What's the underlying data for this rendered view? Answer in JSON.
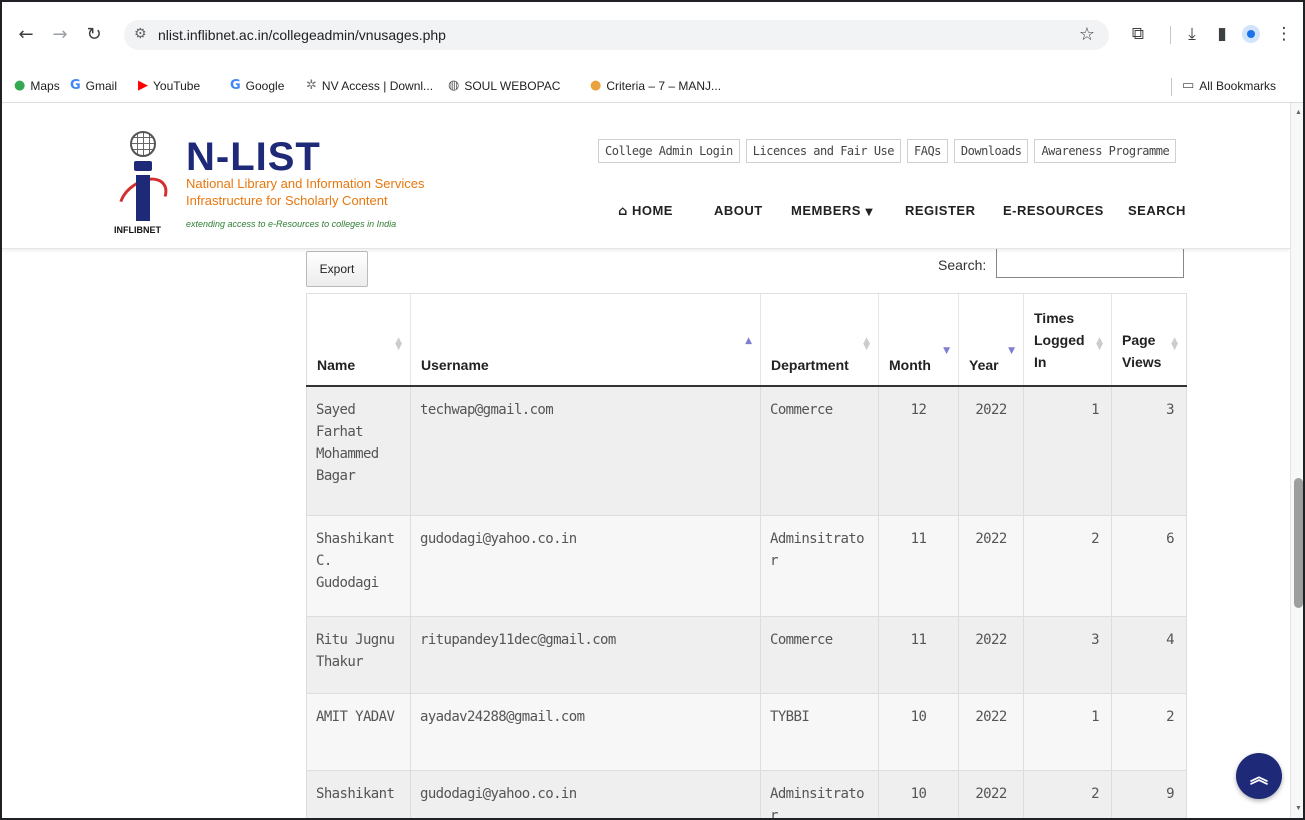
{
  "browser": {
    "url": "nlist.inflibnet.ac.in/collegeadmin/vnusages.php",
    "bookmarks": [
      {
        "label": "Maps",
        "icon": "maps-pin-icon"
      },
      {
        "label": "Gmail",
        "icon": "google-g-icon"
      },
      {
        "label": "YouTube",
        "icon": "youtube-icon"
      },
      {
        "label": "Google",
        "icon": "google-g-icon"
      },
      {
        "label": "NV Access | Downl...",
        "icon": "nv-access-icon"
      },
      {
        "label": "SOUL WEBOPAC",
        "icon": "globe-icon"
      },
      {
        "label": "Criteria – 7 – MANJ...",
        "icon": "site-favicon-icon"
      }
    ],
    "all_bookmarks": "All Bookmarks"
  },
  "site": {
    "brand": "N-LIST",
    "subtitle_line1": "National Library and Information Services",
    "subtitle_line2": "Infrastructure for Scholarly Content",
    "tagline": "extending access to e-Resources to colleges in India",
    "logo_text": "INFLIBNET",
    "top_links": [
      "College Admin Login",
      "Licences and Fair Use",
      "FAQs",
      "Downloads",
      "Awareness Programme"
    ],
    "nav": {
      "home": "HOME",
      "about": "ABOUT",
      "members": "MEMBERS",
      "register": "REGISTER",
      "eresources": "E-RESOURCES",
      "search": "SEARCH"
    }
  },
  "table_controls": {
    "export_label": "Export",
    "search_label": "Search:",
    "search_value": ""
  },
  "table": {
    "columns": [
      "Name",
      "Username",
      "Department",
      "Month",
      "Year",
      "Times Logged In",
      "Page Views"
    ],
    "rows": [
      {
        "name": "Sayed Farhat Mohammed Bagar",
        "username": "techwap@gmail.com",
        "department": "Commerce",
        "month": "12",
        "year": "2022",
        "logged_in": "1",
        "page_views": "3"
      },
      {
        "name": "Shashikant C. Gudodagi",
        "username": "gudodagi@yahoo.co.in",
        "department": "Adminsitrator",
        "month": "11",
        "year": "2022",
        "logged_in": "2",
        "page_views": "6"
      },
      {
        "name": "Ritu Jugnu Thakur",
        "username": "ritupandey11dec@gmail.com",
        "department": "Commerce",
        "month": "11",
        "year": "2022",
        "logged_in": "3",
        "page_views": "4"
      },
      {
        "name": "AMIT YADAV",
        "username": "ayadav24288@gmail.com",
        "department": "TYBBI",
        "month": "10",
        "year": "2022",
        "logged_in": "1",
        "page_views": "2"
      },
      {
        "name": "Shashikant",
        "username": "gudodagi@yahoo.co.in",
        "department": "Adminsitrator",
        "month": "10",
        "year": "2022",
        "logged_in": "2",
        "page_views": "9"
      }
    ]
  }
}
